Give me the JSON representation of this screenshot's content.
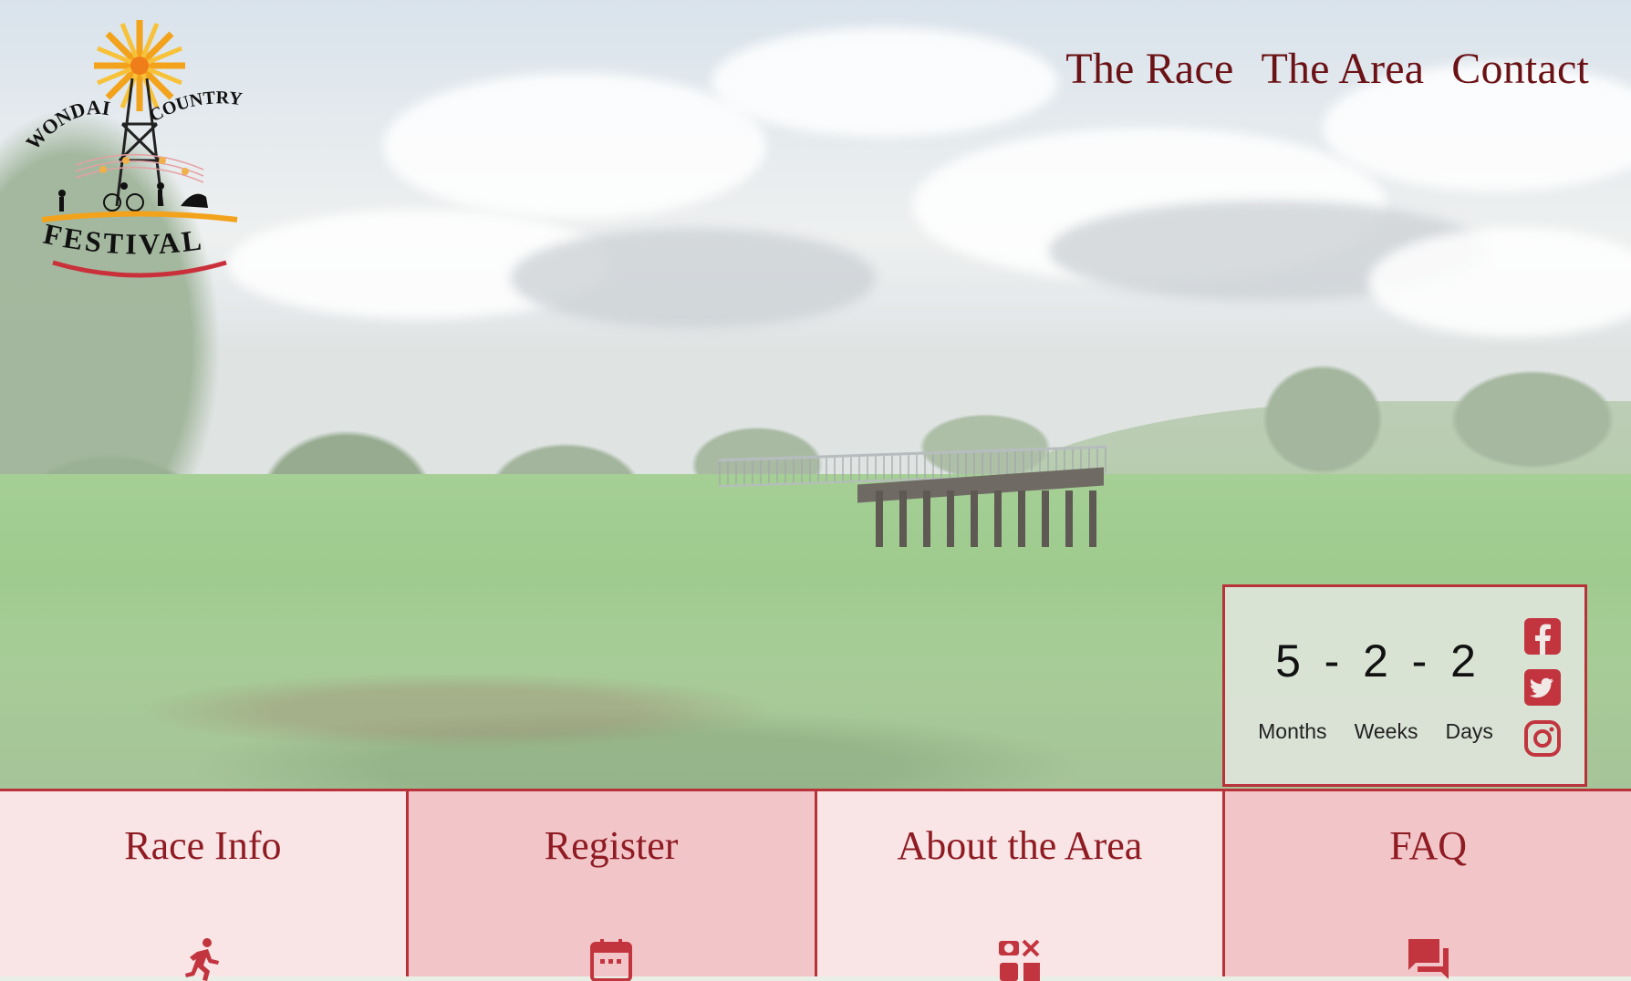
{
  "logo": {
    "name": "Wondai Country Festival",
    "line1_left": "WONDAI",
    "line1_right": "COUNTRY",
    "line2": "FESTIVAL"
  },
  "nav": {
    "items": [
      {
        "label": "The Race"
      },
      {
        "label": "The Area"
      },
      {
        "label": "Contact"
      }
    ]
  },
  "countdown": {
    "values": {
      "months": "5",
      "weeks": "2",
      "days": "2"
    },
    "separator": "-",
    "labels": {
      "months": "Months",
      "weeks": "Weeks",
      "days": "Days"
    }
  },
  "social": {
    "icons": [
      "facebook-icon",
      "twitter-icon",
      "instagram-icon"
    ],
    "color": "#c2353f"
  },
  "tiles": [
    {
      "title": "Race Info",
      "icon": "runner-icon"
    },
    {
      "title": "Register",
      "icon": "calendar-icon"
    },
    {
      "title": "About the Area",
      "icon": "places-icon"
    },
    {
      "title": "FAQ",
      "icon": "chat-icon"
    }
  ],
  "colors": {
    "nav_text": "#6b1216",
    "accent_border": "#b9323a",
    "tile_title": "#8f1b23",
    "tile_light": "#f9e5e6",
    "tile_dark": "#f2c6c9",
    "icon": "#c2353f"
  }
}
